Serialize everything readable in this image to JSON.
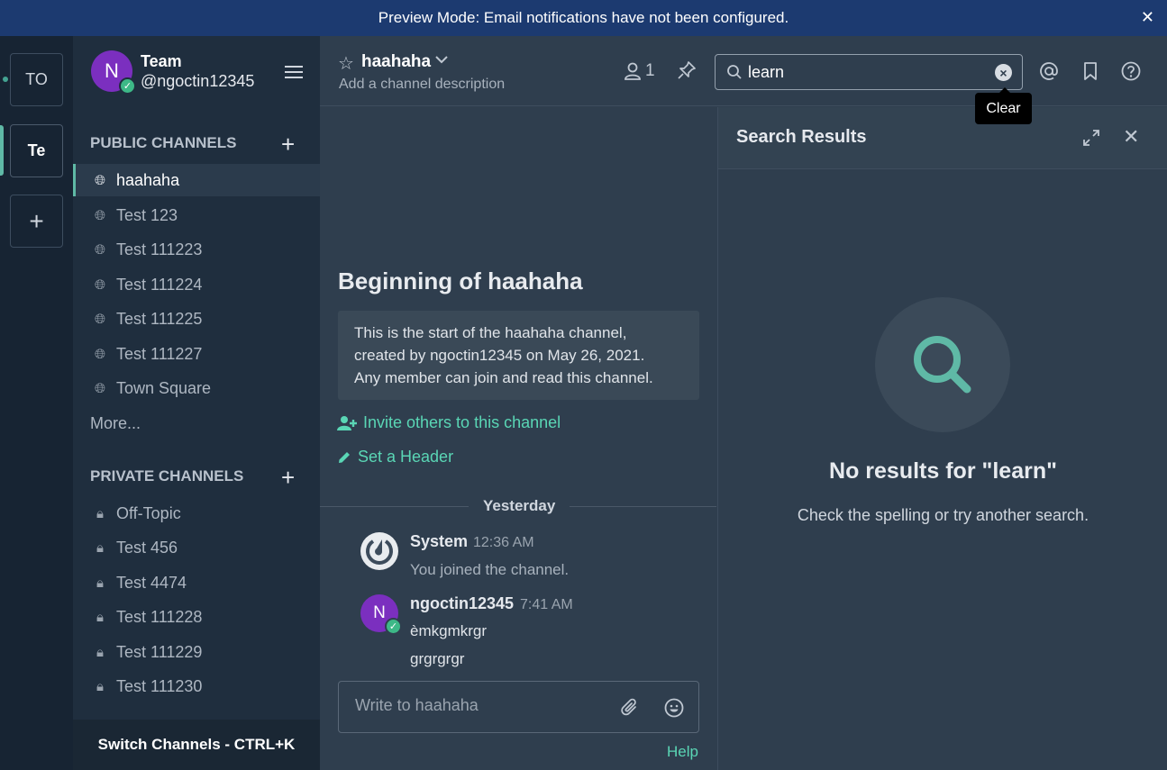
{
  "announcement": {
    "text": "Preview Mode: Email notifications have not been configured.",
    "close": "✕"
  },
  "teams": {
    "items": [
      "TO",
      "Te"
    ],
    "add": "+"
  },
  "sidebar": {
    "team_name": "Team",
    "user_handle": "@ngoctin12345",
    "avatar_initial": "N",
    "public_title": "PUBLIC CHANNELS",
    "public_channels": [
      "haahaha",
      "Test 123",
      "Test 111223",
      "Test 111224",
      "Test 111225",
      "Test 111227",
      "Town Square"
    ],
    "more": "More...",
    "private_title": "PRIVATE CHANNELS",
    "private_channels": [
      "Off-Topic",
      "Test 456",
      "Test 4474",
      "Test 111228",
      "Test 111229",
      "Test 111230"
    ],
    "switch_label": "Switch Channels - CTRL+K"
  },
  "header": {
    "channel_name": "haahaha",
    "description": "Add a channel description",
    "member_count": "1",
    "search_value": "learn",
    "tooltip": "Clear"
  },
  "channel": {
    "intro_title": "Beginning of haahaha",
    "intro_line1": "This is the start of the haahaha channel,",
    "intro_line2": "created by ngoctin12345 on May 26, 2021.",
    "intro_line3": "Any member can join and read this channel.",
    "invite": "Invite others to this channel",
    "set_header": "Set a Header",
    "date_separator": "Yesterday",
    "posts": [
      {
        "author": "System",
        "time": "12:36 AM",
        "messages": [
          "You joined the channel."
        ]
      },
      {
        "author": "ngoctin12345",
        "time": "7:41 AM",
        "avatar_initial": "N",
        "messages": [
          "èmkgmkrgr",
          "grgrgrgr"
        ]
      }
    ],
    "composer_placeholder": "Write to haahaha",
    "help": "Help"
  },
  "search_results": {
    "title": "Search Results",
    "empty_title": "No results for \"learn\"",
    "empty_sub": "Check the spelling or try another search."
  },
  "colors": {
    "accent": "#5ad6b5",
    "banner": "#1c3a70",
    "avatar": "#7b2fbf",
    "sidebar": "#1f2e3e"
  }
}
